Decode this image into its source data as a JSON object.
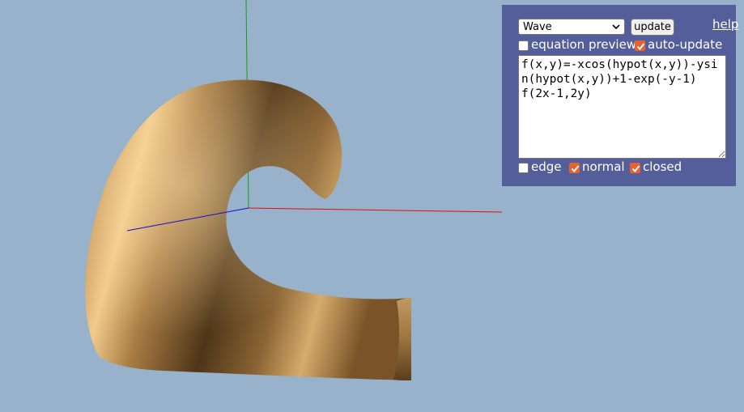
{
  "colors": {
    "background": "#98b2cc",
    "panel": "#545e9a",
    "checkbox_checked": "#e8622d",
    "shape": "#b88c52",
    "axis_x": "#e01010",
    "axis_y": "#10a010",
    "axis_z": "#1010d0"
  },
  "scene": {
    "description_icon": "3d-surface"
  },
  "panel": {
    "preset_select": {
      "selected": "Wave"
    },
    "update_label": "update",
    "help_label": "help",
    "equation_preview": {
      "label": "equation preview",
      "checked": false
    },
    "auto_update": {
      "label": "auto-update",
      "checked": true
    },
    "equation_text": "f(x,y)=-xcos(hypot(x,y))-ysin(hypot(x,y))+1-exp(-y-1)\nf(2x-1,2y)",
    "edge": {
      "label": "edge",
      "checked": false
    },
    "normal": {
      "label": "normal",
      "checked": true
    },
    "closed": {
      "label": "closed",
      "checked": true
    }
  }
}
